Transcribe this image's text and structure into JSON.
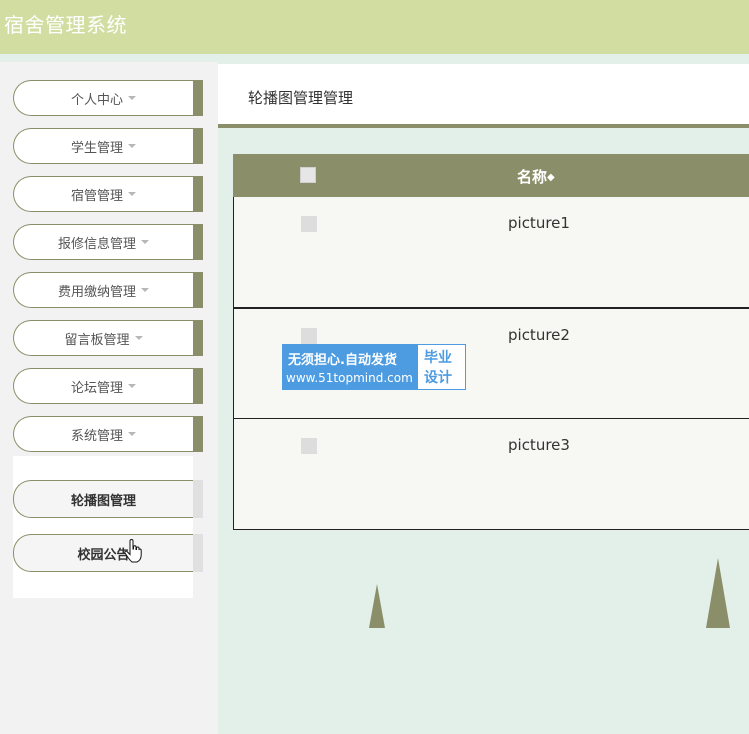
{
  "app": {
    "title": "宿舍管理系统"
  },
  "sidebar": {
    "items": [
      {
        "label": "个人中心"
      },
      {
        "label": "学生管理"
      },
      {
        "label": "宿管管理"
      },
      {
        "label": "报修信息管理"
      },
      {
        "label": "费用缴纳管理"
      },
      {
        "label": "留言板管理"
      },
      {
        "label": "论坛管理"
      },
      {
        "label": "系统管理"
      }
    ],
    "submenu": [
      {
        "label": "轮播图管理"
      },
      {
        "label": "校园公告"
      }
    ]
  },
  "page": {
    "title": "轮播图管理管理"
  },
  "table": {
    "header": {
      "name": "名称",
      "sort_icon": "sort-icon"
    },
    "rows": [
      {
        "name": "picture1"
      },
      {
        "name": "picture2"
      },
      {
        "name": "picture3"
      }
    ]
  },
  "watermark": {
    "line1": "无须担心.自动发货",
    "line2": "www.51topmind.com",
    "right1": "毕业",
    "right2": "设计"
  },
  "colors": {
    "accent": "#8a8f69",
    "topbar": "#d1dda1",
    "background": "#e3efe9"
  }
}
